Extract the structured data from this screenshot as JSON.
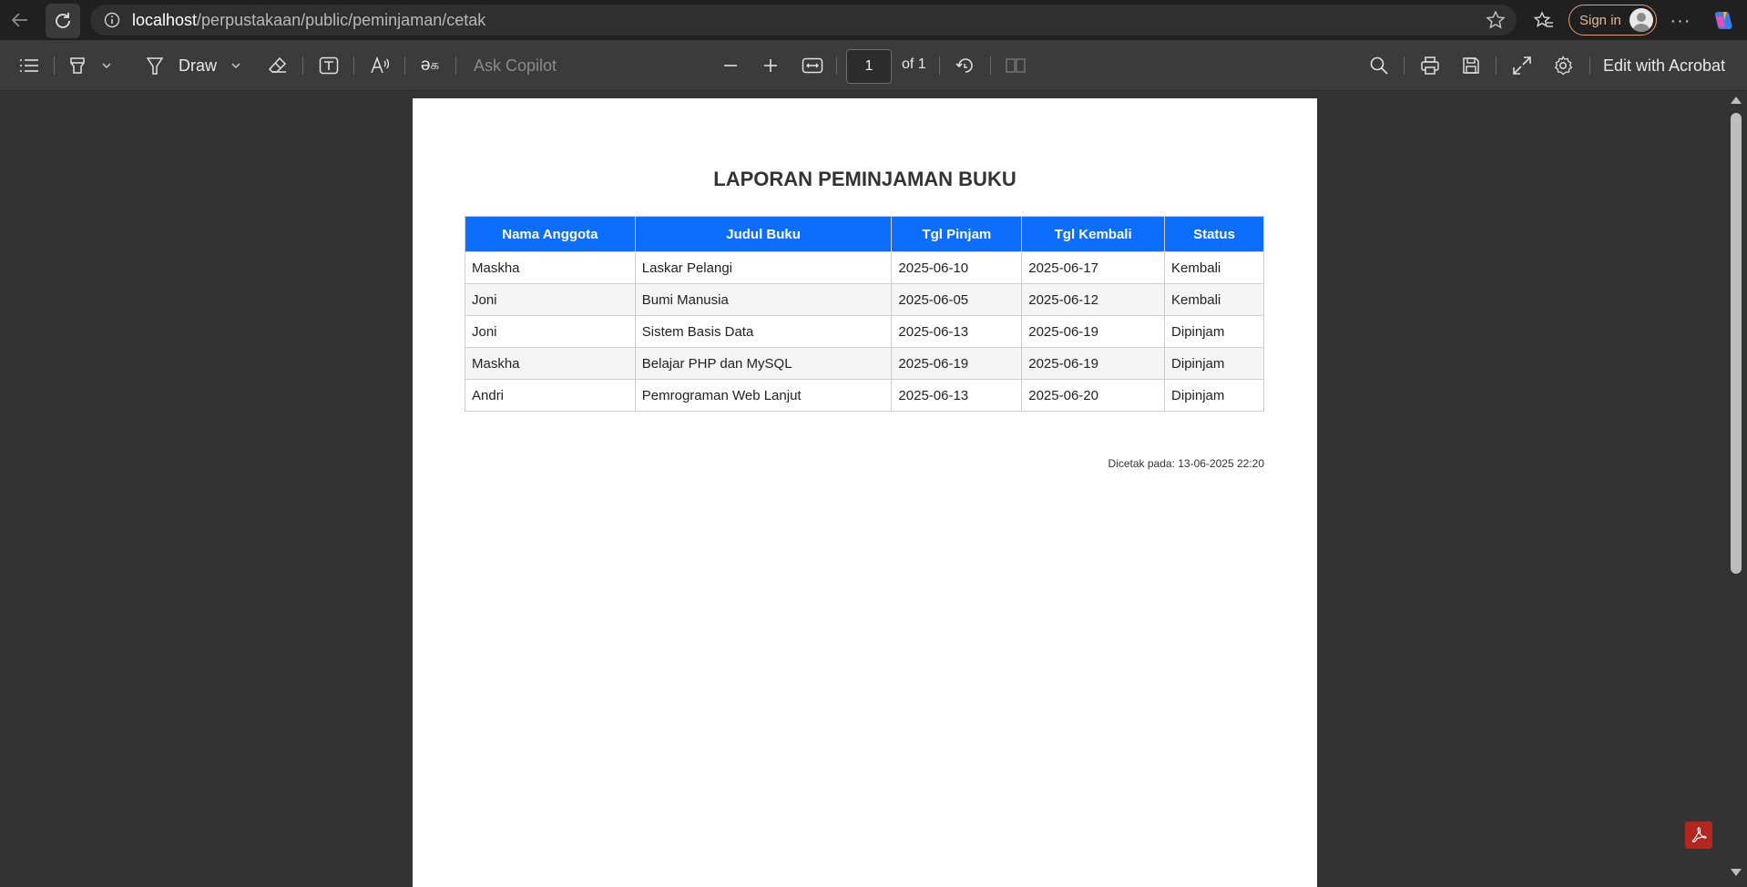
{
  "browser": {
    "url_host": "localhost",
    "url_path": "/perpustakaan/public/peminjaman/cetak",
    "signin_label": "Sign in",
    "more_label": "···"
  },
  "toolbar": {
    "draw_label": "Draw",
    "ask_copilot_label": "Ask Copilot",
    "page_current": "1",
    "page_total_label": "of 1",
    "edit_acrobat_label": "Edit with Acrobat",
    "icons": [
      "contents-icon",
      "highlight-icon",
      "draw-icon",
      "eraser-icon",
      "textbox-icon",
      "read-aloud-icon",
      "translate-icon",
      "zoom-out-icon",
      "zoom-in-icon",
      "fit-width-icon",
      "rotate-icon",
      "page-view-icon",
      "search-icon",
      "print-icon",
      "save-icon",
      "fullscreen-icon",
      "settings-icon"
    ]
  },
  "report": {
    "title": "LAPORAN PEMINJAMAN BUKU",
    "headers": [
      "Nama Anggota",
      "Judul Buku",
      "Tgl Pinjam",
      "Tgl Kembali",
      "Status"
    ],
    "rows": [
      [
        "Maskha",
        "Laskar Pelangi",
        "2025-06-10",
        "2025-06-17",
        "Kembali"
      ],
      [
        "Joni",
        "Bumi Manusia",
        "2025-06-05",
        "2025-06-12",
        "Kembali"
      ],
      [
        "Joni",
        "Sistem Basis Data",
        "2025-06-13",
        "2025-06-19",
        "Dipinjam"
      ],
      [
        "Maskha",
        "Belajar PHP dan MySQL",
        "2025-06-19",
        "2025-06-19",
        "Dipinjam"
      ],
      [
        "Andri",
        "Pemrograman Web Lanjut",
        "2025-06-13",
        "2025-06-20",
        "Dipinjam"
      ]
    ],
    "printed_at": "Dicetak pada: 13-06-2025 22:20"
  },
  "colors": {
    "header_bg": "#0d6efd",
    "viewer_bg": "#333333",
    "toolbar_bg": "#3b3b3b",
    "browser_bg": "#202020"
  }
}
